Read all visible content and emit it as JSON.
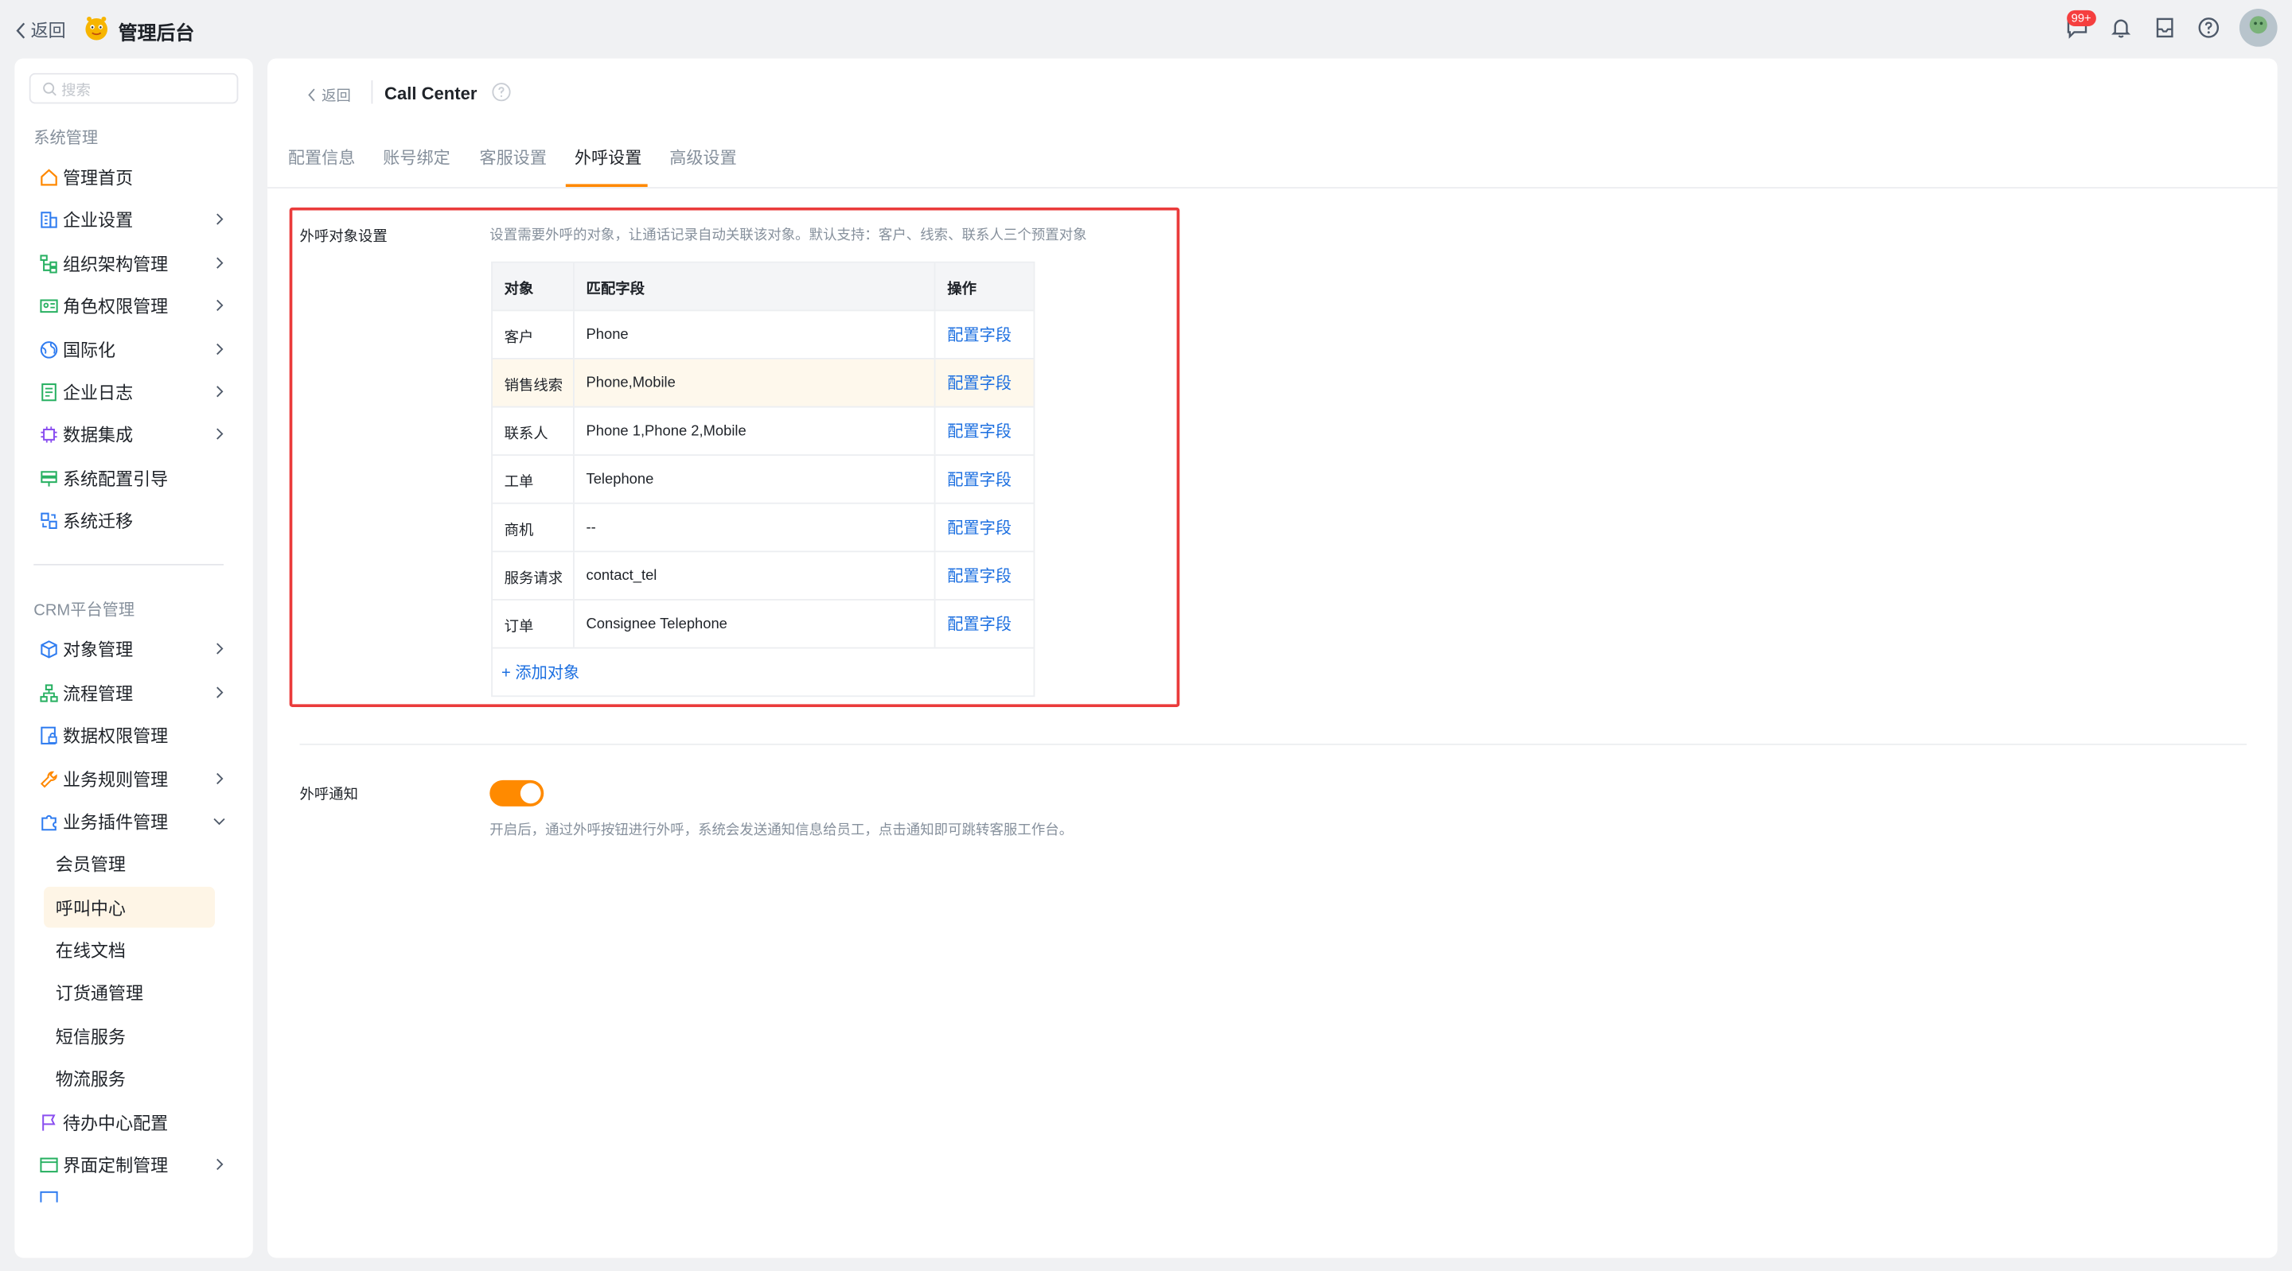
{
  "topbar": {
    "back_label": "返回",
    "app_title": "管理后台",
    "notification_badge": "99+"
  },
  "sidebar": {
    "search_placeholder": "搜索",
    "group1_title": "系统管理",
    "group1_items": [
      {
        "label": "管理首页",
        "icon": "home-icon",
        "has_arrow": false
      },
      {
        "label": "企业设置",
        "icon": "building-icon",
        "has_arrow": true
      },
      {
        "label": "组织架构管理",
        "icon": "org-tree-icon",
        "has_arrow": true
      },
      {
        "label": "角色权限管理",
        "icon": "id-card-icon",
        "has_arrow": true
      },
      {
        "label": "国际化",
        "icon": "globe-icon",
        "has_arrow": true
      },
      {
        "label": "企业日志",
        "icon": "log-icon",
        "has_arrow": true
      },
      {
        "label": "数据集成",
        "icon": "chip-icon",
        "has_arrow": true
      },
      {
        "label": "系统配置引导",
        "icon": "signpost-icon",
        "has_arrow": false
      },
      {
        "label": "系统迁移",
        "icon": "migrate-icon",
        "has_arrow": false
      }
    ],
    "group2_title": "CRM平台管理",
    "group2_items": [
      {
        "label": "对象管理",
        "icon": "cube-icon",
        "has_arrow": true
      },
      {
        "label": "流程管理",
        "icon": "flow-icon",
        "has_arrow": true
      },
      {
        "label": "数据权限管理",
        "icon": "data-lock-icon",
        "has_arrow": false
      },
      {
        "label": "业务规则管理",
        "icon": "wrench-icon",
        "has_arrow": true
      },
      {
        "label": "业务插件管理",
        "icon": "puzzle-icon",
        "has_arrow": "down"
      }
    ],
    "plugin_sub_items": [
      "会员管理",
      "呼叫中心",
      "在线文档",
      "订货通管理",
      "短信服务",
      "物流服务"
    ],
    "active_sub_item": "呼叫中心",
    "group3_items": [
      {
        "label": "待办中心配置",
        "icon": "flag-icon",
        "has_arrow": false
      },
      {
        "label": "界面定制管理",
        "icon": "layout-icon",
        "has_arrow": true
      }
    ]
  },
  "main": {
    "back_label": "返回",
    "page_title": "Call Center",
    "tabs": [
      "配置信息",
      "账号绑定",
      "客服设置",
      "外呼设置",
      "高级设置"
    ],
    "active_tab": "外呼设置",
    "outbound_section": {
      "label": "外呼对象设置",
      "description": "设置需要外呼的对象，让通话记录自动关联该对象。默认支持：客户、线索、联系人三个预置对象",
      "columns": [
        "对象",
        "匹配字段",
        "操作"
      ],
      "rows": [
        {
          "object": "客户",
          "fields": "Phone",
          "action": "配置字段"
        },
        {
          "object": "销售线索",
          "fields": "Phone,Mobile",
          "action": "配置字段"
        },
        {
          "object": "联系人",
          "fields": "Phone 1,Phone 2,Mobile",
          "action": "配置字段"
        },
        {
          "object": "工单",
          "fields": "Telephone",
          "action": "配置字段"
        },
        {
          "object": "商机",
          "fields": "--",
          "action": "配置字段"
        },
        {
          "object": "服务请求",
          "fields": "contact_tel",
          "action": "配置字段"
        },
        {
          "object": "订单",
          "fields": "Consignee Telephone",
          "action": "配置字段"
        }
      ],
      "add_label": "+ 添加对象"
    },
    "notify_section": {
      "label": "外呼通知",
      "toggle_on": true,
      "description": "开启后，通过外呼按钮进行外呼，系统会发送通知信息给员工，点击通知即可跳转客服工作台。"
    }
  },
  "colors": {
    "accent": "#ff8800",
    "link": "#1c6fe0",
    "highlight_border": "#ea3b3b"
  }
}
